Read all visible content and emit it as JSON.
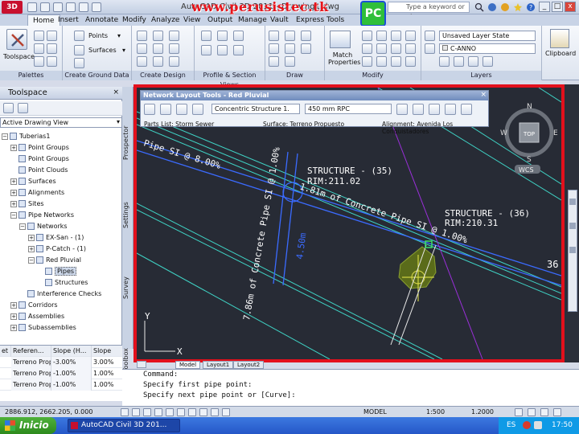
{
  "title_bar": {
    "app_button": "3D",
    "window_title": "AutoCAD Civil 3D 2011 - Drawing1.dwg",
    "watermark": "www.perusistec.tk",
    "search_placeholder": "Type a keyword or phrase"
  },
  "ribbon_tabs": [
    "Home",
    "Insert",
    "Annotate",
    "Modify",
    "Analyze",
    "View",
    "Output",
    "Manage",
    "Vault",
    "Express Tools"
  ],
  "ribbon": {
    "toolspace_label": "Toolspace",
    "points_label": "Points",
    "surfaces_label": "Surfaces",
    "match_properties_label": "Match Properties",
    "layer_state": "Unsaved Layer State",
    "layer_name": "C-ANNO",
    "clipboard_label": "Clipboard",
    "panels": [
      "Palettes",
      "Create Ground Data",
      "Create Design",
      "Profile & Section Views",
      "Draw",
      "Modify",
      "Layers"
    ]
  },
  "toolspace": {
    "title": "Toolspace",
    "view_selector": "Active Drawing View",
    "tree": [
      {
        "label": "Tuberias1",
        "level": 0,
        "expander": "−"
      },
      {
        "label": "Point Groups",
        "level": 1,
        "expander": "+"
      },
      {
        "label": "Point Groups",
        "level": 1,
        "expander": ""
      },
      {
        "label": "Point Clouds",
        "level": 1,
        "expander": ""
      },
      {
        "label": "Surfaces",
        "level": 1,
        "expander": "+"
      },
      {
        "label": "Alignments",
        "level": 1,
        "expander": "+"
      },
      {
        "label": "Sites",
        "level": 1,
        "expander": "+"
      },
      {
        "label": "Pipe Networks",
        "level": 1,
        "expander": "−"
      },
      {
        "label": "Networks",
        "level": 2,
        "expander": "−"
      },
      {
        "label": "EX-San - (1)",
        "level": 3,
        "expander": "+"
      },
      {
        "label": "P-Catch - (1)",
        "level": 3,
        "expander": "+"
      },
      {
        "label": "Red Pluvial",
        "level": 3,
        "expander": "−"
      },
      {
        "label": "Pipes",
        "level": 4,
        "expander": "",
        "selected": true
      },
      {
        "label": "Structures",
        "level": 4,
        "expander": ""
      },
      {
        "label": "Interference Checks",
        "level": 2,
        "expander": ""
      },
      {
        "label": "Corridors",
        "level": 1,
        "expander": "+"
      },
      {
        "label": "Assemblies",
        "level": 1,
        "expander": "+"
      },
      {
        "label": "Subassemblies",
        "level": 1,
        "expander": "+"
      }
    ],
    "side_tabs": [
      "Prospector",
      "Settings",
      "Survey",
      "Toolbox"
    ]
  },
  "pipe_grid": {
    "columns": [
      "et",
      "Referen...",
      "Slope (H...",
      "Slope"
    ],
    "rows": [
      [
        "",
        "Terreno Prop",
        "-3.00%",
        "3.00%"
      ],
      [
        "",
        "Terreno Prop",
        "-1.00%",
        "1.00%"
      ],
      [
        "",
        "Terreno Prop",
        "-1.00%",
        "1.00%"
      ]
    ]
  },
  "network_tools": {
    "title": "Network Layout Tools - Red Pluvial",
    "structure": "Concentric Structure 1.",
    "pipe": "450 mm RPC",
    "parts_list": "Parts List: Storm Sewer",
    "surface": "Surface: Terreno Propuesto",
    "alignment": "Alignment: Avenida Los Conquistadores"
  },
  "drawing": {
    "annotations": {
      "slope_label": "Pipe SI @ 8.00%",
      "structure_35": "STRUCTURE - (35)",
      "rim_35": "RIM:211.02",
      "pipe_label_1": "1.81m of Concrete Pipe SI @ 1.00%",
      "structure_36": "STRUCTURE - (36)",
      "rim_36": "RIM:210.31",
      "pipe_label_2": "7.86m of Concrete Pipe SI @ 1.00%",
      "length_label": "4.50m",
      "pipe_number": "36",
      "axis_y": "Y",
      "axis_x": "X"
    },
    "viewcube_label": "TOP",
    "compass": [
      "N",
      "E",
      "S",
      "W"
    ],
    "wcs_label": "WCS"
  },
  "layout_tabs": [
    "Model",
    "Layout1",
    "Layout2"
  ],
  "command_line": [
    "Command:",
    "Specify first pipe point:",
    "Specify next pipe point or [Curve]:"
  ],
  "status_bar": {
    "coordinates": "2886.912, 2662.205, 0.000",
    "model": "MODEL",
    "scale": "1:500",
    "zoom": "1.2000"
  },
  "taskbar": {
    "start": "Inicio",
    "task": "AutoCAD Civil 3D 201...",
    "language": "ES",
    "clock": "17:50"
  }
}
